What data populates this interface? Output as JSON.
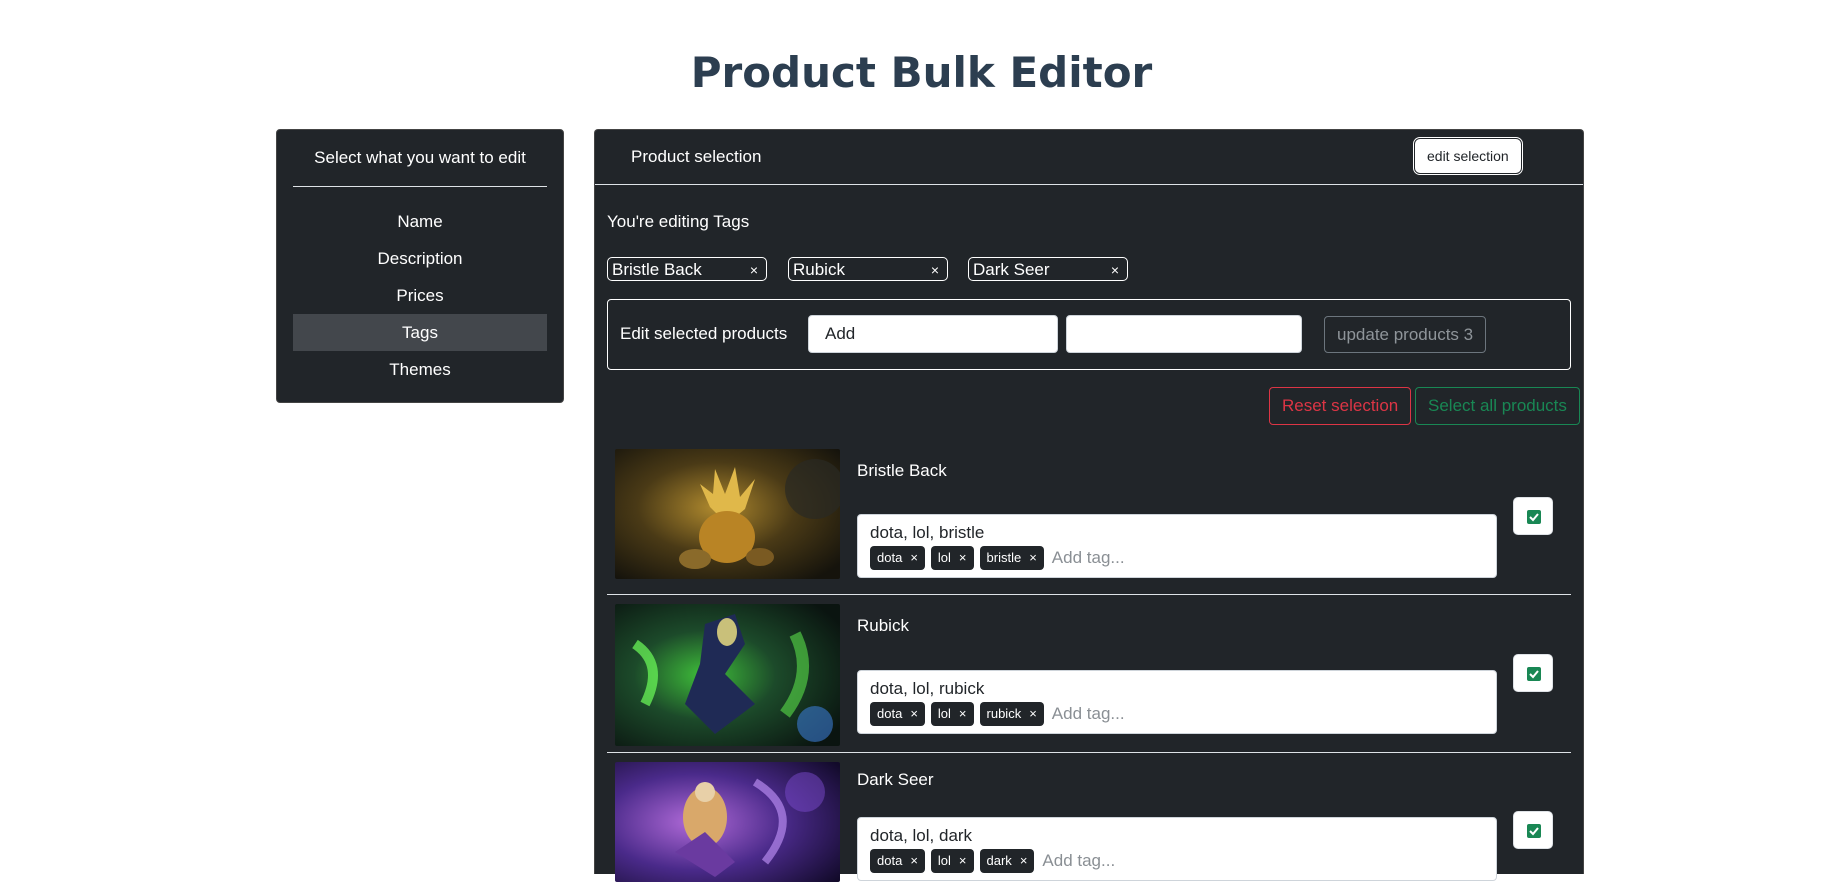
{
  "page": {
    "title": "Product Bulk Editor"
  },
  "sidebar": {
    "header": "Select what you want to edit",
    "items": [
      {
        "label": "Name",
        "active": false
      },
      {
        "label": "Description",
        "active": false
      },
      {
        "label": "Prices",
        "active": false
      },
      {
        "label": "Tags",
        "active": true
      },
      {
        "label": "Themes",
        "active": false
      }
    ]
  },
  "main": {
    "header": {
      "title": "Product selection",
      "edit_button": "edit selection"
    },
    "editing_text": "You're editing Tags",
    "selected_chips": [
      {
        "label": "Bristle Back",
        "remove": "×"
      },
      {
        "label": "Rubick",
        "remove": "×"
      },
      {
        "label": "Dark Seer",
        "remove": "×"
      }
    ],
    "edit_box": {
      "label": "Edit selected products",
      "mode_value": "Add",
      "value_input": "",
      "update_button": "update products 3"
    },
    "reset_button": "Reset selection",
    "select_all_button": "Select all products"
  },
  "products": [
    {
      "name": "Bristle Back",
      "tags_text": "dota, lol, bristle",
      "tags": [
        "dota",
        "lol",
        "bristle"
      ],
      "add_tag_placeholder": "Add tag...",
      "selected": true
    },
    {
      "name": "Rubick",
      "tags_text": "dota, lol, rubick",
      "tags": [
        "dota",
        "lol",
        "rubick"
      ],
      "add_tag_placeholder": "Add tag...",
      "selected": true
    },
    {
      "name": "Dark Seer",
      "tags_text": "dota, lol, dark",
      "tags": [
        "dota",
        "lol",
        "dark"
      ],
      "add_tag_placeholder": "Add tag...",
      "selected": true
    }
  ],
  "icons": {
    "remove": "close-icon",
    "checkbox": "check-icon"
  },
  "colors": {
    "panel": "#212529",
    "danger": "#dc3545",
    "success": "#198754",
    "title": "#2c3e50"
  }
}
